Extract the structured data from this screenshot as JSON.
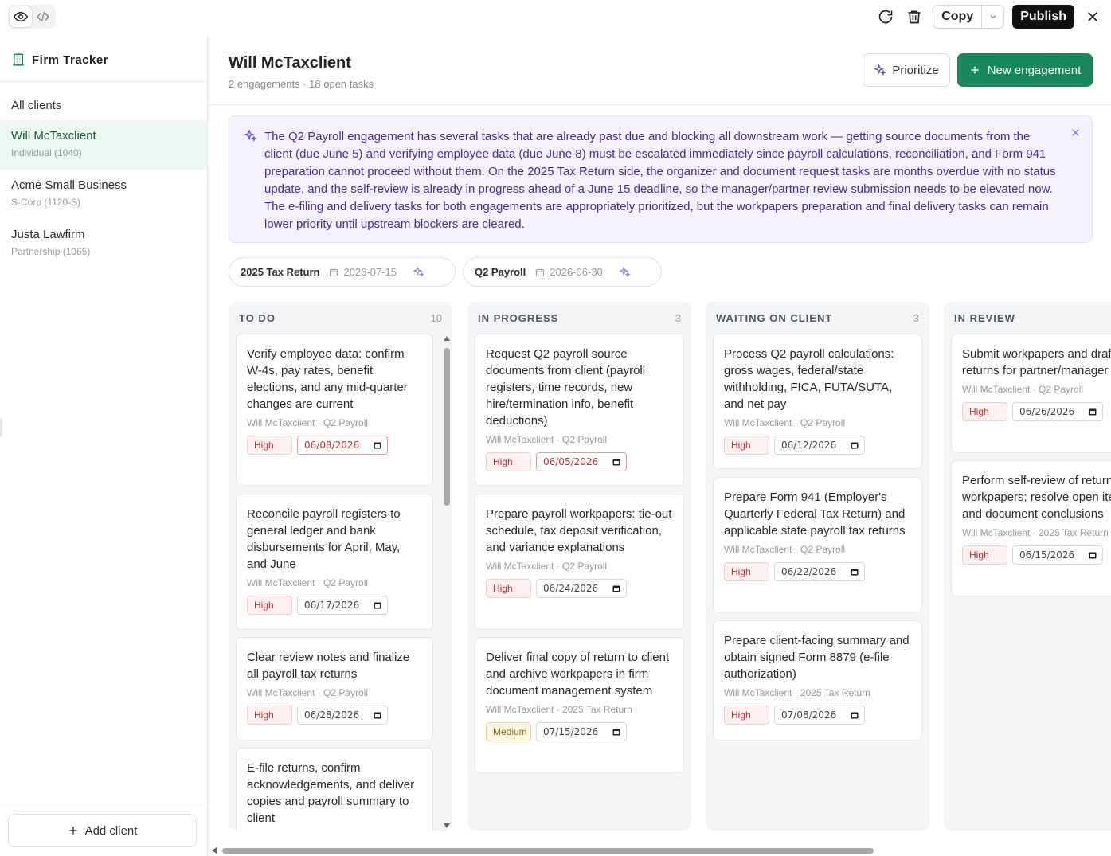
{
  "topbar": {
    "copy_label": "Copy",
    "publish_label": "Publish"
  },
  "sidebar": {
    "brand": "Firm Tracker",
    "all_clients": "All clients",
    "clients": [
      {
        "name": "Will McTaxclient",
        "type": "Individual (1040)",
        "active": true
      },
      {
        "name": "Acme Small Business",
        "type": "S-Corp (1120-S)",
        "active": false
      },
      {
        "name": "Justa Lawfirm",
        "type": "Partnership (1065)",
        "active": false
      }
    ],
    "add_client": "Add client"
  },
  "header": {
    "title": "Will McTaxclient",
    "subtitle": "2 engagements · 18 open tasks",
    "prioritize_label": "Prioritize",
    "new_engagement_label": "New engagement"
  },
  "ai_banner": {
    "text": "The Q2 Payroll engagement has several tasks that are already past due and blocking all downstream work — getting source documents from the client (due June 5) and verifying employee data (due June 8) must be escalated immediately since payroll calculations, reconciliation, and Form 941 preparation cannot proceed without them. On the 2025 Tax Return side, the organizer and document request tasks are months overdue with no status update, and the self-review is already in progress ahead of a June 15 deadline, so the manager/partner review submission needs to be elevated now. The e-filing and delivery tasks for both engagements are appropriately prioritized, but the workpapers preparation and final delivery tasks can remain lower priority until upstream blockers are cleared."
  },
  "engagements": [
    {
      "name": "2025 Tax Return",
      "date": "2026-07-15"
    },
    {
      "name": "Q2 Payroll",
      "date": "2026-06-30"
    }
  ],
  "columns": {
    "todo": {
      "title": "TO DO",
      "count": "10",
      "cards": [
        {
          "title": "Verify employee data: confirm W-4s, pay rates, benefit elections, and any mid-quarter changes are current",
          "meta": "Will McTaxclient · Q2 Payroll",
          "priority": "High",
          "date": "06/08/2026"
        },
        {
          "title": "Reconcile payroll registers to general ledger and bank disbursements for April, May, and June",
          "meta": "Will McTaxclient · Q2 Payroll",
          "priority": "High",
          "date": "06/17/2026"
        },
        {
          "title": "Clear review notes and finalize all payroll tax returns",
          "meta": "Will McTaxclient · Q2 Payroll",
          "priority": "High",
          "date": "06/28/2026"
        },
        {
          "title": "E-file returns, confirm acknowledgements, and deliver copies and payroll summary to client"
        }
      ]
    },
    "inprogress": {
      "title": "IN PROGRESS",
      "count": "3",
      "cards": [
        {
          "title": "Request Q2 payroll source documents from client (payroll registers, time records, new hire/termination info, benefit deductions)",
          "meta": "Will McTaxclient · Q2 Payroll",
          "priority": "High",
          "date": "06/05/2026"
        },
        {
          "title": "Prepare payroll workpapers: tie-out schedule, tax deposit verification, and variance explanations",
          "meta": "Will McTaxclient · Q2 Payroll",
          "priority": "High",
          "date": "06/24/2026"
        },
        {
          "title": "Deliver final copy of return to client and archive workpapers in firm document management system",
          "meta": "Will McTaxclient · 2025 Tax Return",
          "priority": "Medium",
          "date": "07/15/2026"
        }
      ]
    },
    "waiting": {
      "title": "WAITING ON CLIENT",
      "count": "3",
      "cards": [
        {
          "title": "Process Q2 payroll calculations: gross wages, federal/state withholding, FICA, FUTA/SUTA, and net pay",
          "meta": "Will McTaxclient · Q2 Payroll",
          "priority": "High",
          "date": "06/12/2026"
        },
        {
          "title": "Prepare Form 941 (Employer's Quarterly Federal Tax Return) and applicable state payroll tax returns",
          "meta": "Will McTaxclient · Q2 Payroll",
          "priority": "High",
          "date": "06/22/2026"
        },
        {
          "title": "Prepare client-facing summary and obtain signed Form 8879 (e-file authorization)",
          "meta": "Will McTaxclient · 2025 Tax Return",
          "priority": "High",
          "date": "07/08/2026"
        }
      ]
    },
    "review": {
      "title": "IN REVIEW",
      "cards": [
        {
          "title": "Submit workpapers and draft returns for partner/manager review",
          "meta": "Will McTaxclient · Q2 Payroll",
          "priority": "High",
          "date": "06/26/2026"
        },
        {
          "title": "Perform self-review of return and workpapers; resolve open items and document conclusions",
          "meta": "Will McTaxclient · 2025 Tax Return",
          "priority": "High",
          "date": "06/15/2026"
        }
      ]
    }
  }
}
